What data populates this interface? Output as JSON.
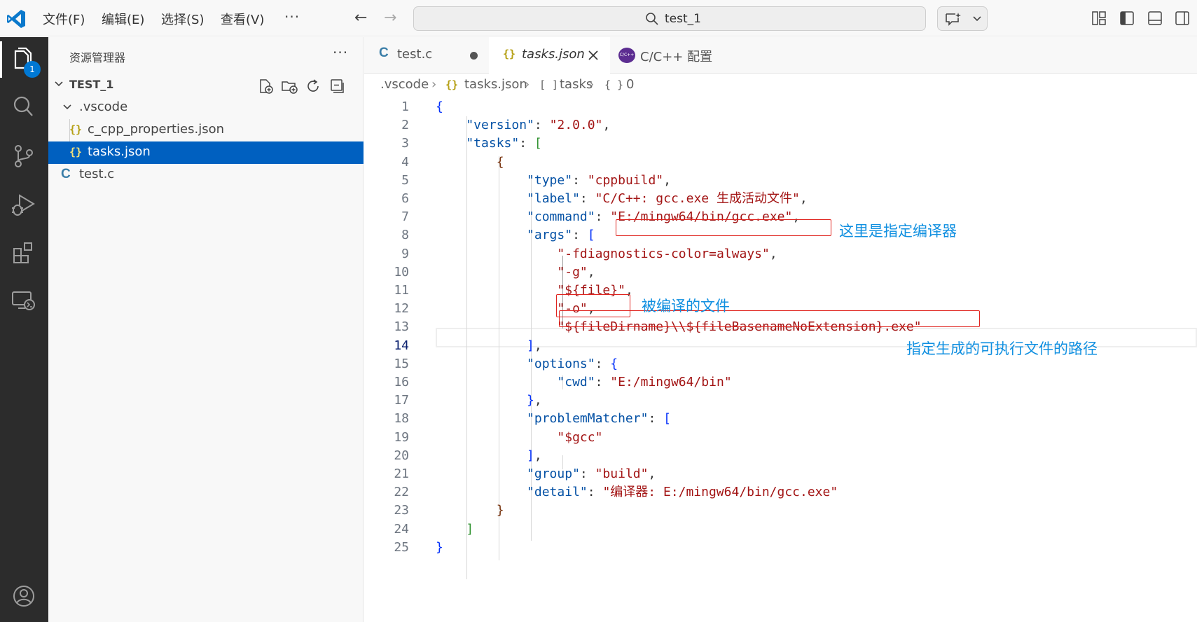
{
  "menu": {
    "file": "文件(F)",
    "edit": "编辑(E)",
    "select": "选择(S)",
    "view": "查看(V)",
    "more": "···"
  },
  "command_center": {
    "text": "test_1"
  },
  "activity": {
    "explorer_badge": "1"
  },
  "sidebar": {
    "title": "资源管理器",
    "more": "···",
    "workspace": "TEST_1",
    "tree": [
      {
        "label": ".vscode",
        "type": "folder"
      },
      {
        "label": "c_cpp_properties.json",
        "type": "json"
      },
      {
        "label": "tasks.json",
        "type": "json",
        "selected": true
      },
      {
        "label": "test.c",
        "type": "c"
      }
    ],
    "json_icon": "{}",
    "c_icon": "C"
  },
  "tabs": [
    {
      "label": "test.c",
      "icon": "C",
      "modified": true
    },
    {
      "label": "tasks.json",
      "icon": "{}",
      "active": true
    },
    {
      "label": "C/C++ 配置",
      "icon": "C/C++"
    }
  ],
  "breadcrumb": {
    "folder": ".vscode",
    "file": "tasks.json",
    "array": "tasks",
    "array_icon": "[ ]",
    "obj": "0",
    "obj_icon": "{ }"
  },
  "editor": {
    "current_line": 14,
    "line_numbers": [
      "1",
      "2",
      "3",
      "4",
      "5",
      "6",
      "7",
      "8",
      "9",
      "10",
      "11",
      "12",
      "13",
      "14",
      "15",
      "16",
      "17",
      "18",
      "19",
      "20",
      "21",
      "22",
      "23",
      "24",
      "25"
    ],
    "lines": [
      [
        {
          "t": "{",
          "c": "b1"
        }
      ],
      [
        {
          "t": "    \"version\"",
          "c": "k"
        },
        {
          "t": ": ",
          "c": "p"
        },
        {
          "t": "\"2.0.0\"",
          "c": "s"
        },
        {
          "t": ",",
          "c": "p"
        }
      ],
      [
        {
          "t": "    \"tasks\"",
          "c": "k"
        },
        {
          "t": ": ",
          "c": "p"
        },
        {
          "t": "[",
          "c": "b2"
        }
      ],
      [
        {
          "t": "        {",
          "c": "b3"
        }
      ],
      [
        {
          "t": "            \"type\"",
          "c": "k"
        },
        {
          "t": ": ",
          "c": "p"
        },
        {
          "t": "\"cppbuild\"",
          "c": "s"
        },
        {
          "t": ",",
          "c": "p"
        }
      ],
      [
        {
          "t": "            \"label\"",
          "c": "k"
        },
        {
          "t": ": ",
          "c": "p"
        },
        {
          "t": "\"C/C++: gcc.exe 生成活动文件\"",
          "c": "s"
        },
        {
          "t": ",",
          "c": "p"
        }
      ],
      [
        {
          "t": "            \"command\"",
          "c": "k"
        },
        {
          "t": ": ",
          "c": "p"
        },
        {
          "t": "\"E:/mingw64/bin/gcc.exe\"",
          "c": "s"
        },
        {
          "t": ",",
          "c": "p"
        }
      ],
      [
        {
          "t": "            \"args\"",
          "c": "k"
        },
        {
          "t": ": ",
          "c": "p"
        },
        {
          "t": "[",
          "c": "b1"
        }
      ],
      [
        {
          "t": "                \"-fdiagnostics-color=always\"",
          "c": "s"
        },
        {
          "t": ",",
          "c": "p"
        }
      ],
      [
        {
          "t": "                \"-g\"",
          "c": "s"
        },
        {
          "t": ",",
          "c": "p"
        }
      ],
      [
        {
          "t": "                \"${file}\"",
          "c": "s"
        },
        {
          "t": ",",
          "c": "p"
        }
      ],
      [
        {
          "t": "                \"-o\"",
          "c": "s"
        },
        {
          "t": ",",
          "c": "p"
        }
      ],
      [
        {
          "t": "                \"${fileDirname}\\\\${fileBasenameNoExtension}.exe\"",
          "c": "s"
        }
      ],
      [
        {
          "t": "            ]",
          "c": "b1"
        },
        {
          "t": ",",
          "c": "p"
        }
      ],
      [
        {
          "t": "            \"options\"",
          "c": "k"
        },
        {
          "t": ": ",
          "c": "p"
        },
        {
          "t": "{",
          "c": "b1"
        }
      ],
      [
        {
          "t": "                \"cwd\"",
          "c": "k"
        },
        {
          "t": ": ",
          "c": "p"
        },
        {
          "t": "\"E:/mingw64/bin\"",
          "c": "s"
        }
      ],
      [
        {
          "t": "            }",
          "c": "b1"
        },
        {
          "t": ",",
          "c": "p"
        }
      ],
      [
        {
          "t": "            \"problemMatcher\"",
          "c": "k"
        },
        {
          "t": ": ",
          "c": "p"
        },
        {
          "t": "[",
          "c": "b1"
        }
      ],
      [
        {
          "t": "                \"$gcc\"",
          "c": "s"
        }
      ],
      [
        {
          "t": "            ]",
          "c": "b1"
        },
        {
          "t": ",",
          "c": "p"
        }
      ],
      [
        {
          "t": "            \"group\"",
          "c": "k"
        },
        {
          "t": ": ",
          "c": "p"
        },
        {
          "t": "\"build\"",
          "c": "s"
        },
        {
          "t": ",",
          "c": "p"
        }
      ],
      [
        {
          "t": "            \"detail\"",
          "c": "k"
        },
        {
          "t": ": ",
          "c": "p"
        },
        {
          "t": "\"编译器: E:/mingw64/bin/gcc.exe\"",
          "c": "s"
        }
      ],
      [
        {
          "t": "        }",
          "c": "b3"
        }
      ],
      [
        {
          "t": "    ]",
          "c": "b2"
        }
      ],
      [
        {
          "t": "}",
          "c": "b1"
        }
      ]
    ]
  },
  "annotations": {
    "compiler": "这里是指定编译器",
    "file": "被编译的文件",
    "output": "指定生成的可执行文件的路径"
  },
  "colors": {
    "accent": "#0078d4",
    "selection": "#0060c0",
    "annotation": "#0f8fe0",
    "highlight_box": "#e0241f"
  }
}
